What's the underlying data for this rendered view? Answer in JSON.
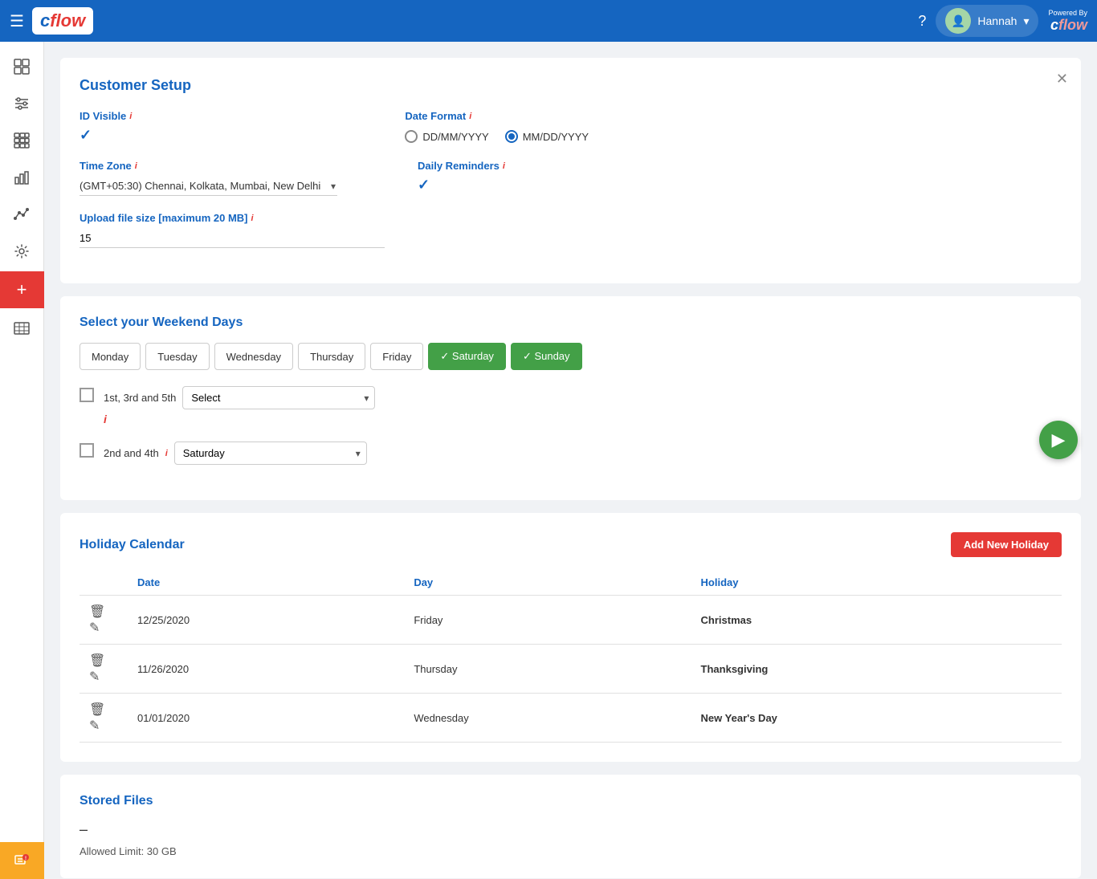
{
  "app": {
    "name": "cflow",
    "powered_by": "Powered By"
  },
  "user": {
    "name": "Hannah"
  },
  "customer_setup": {
    "title": "Customer Setup",
    "id_visible": {
      "label": "ID Visible",
      "checked": true
    },
    "date_format": {
      "label": "Date Format",
      "options": [
        "DD/MM/YYYY",
        "MM/DD/YYYY"
      ],
      "selected": "MM/DD/YYYY"
    },
    "time_zone": {
      "label": "Time Zone",
      "value": "(GMT+05:30) Chennai, Kolkata, Mumbai, New Delhi"
    },
    "daily_reminders": {
      "label": "Daily Reminders",
      "checked": true
    },
    "upload_file_size": {
      "label": "Upload file size [maximum 20 MB]",
      "value": "15"
    }
  },
  "weekend": {
    "title": "Select your Weekend Days",
    "days": [
      {
        "label": "Monday",
        "selected": false
      },
      {
        "label": "Tuesday",
        "selected": false
      },
      {
        "label": "Wednesday",
        "selected": false
      },
      {
        "label": "Thursday",
        "selected": false
      },
      {
        "label": "Friday",
        "selected": false
      },
      {
        "label": "Saturday",
        "selected": true
      },
      {
        "label": "Sunday",
        "selected": true
      }
    ],
    "row1": {
      "label": "1st, 3rd and 5th",
      "select_value": "Select",
      "select_placeholder": "Select"
    },
    "row2": {
      "label": "2nd and 4th",
      "select_value": "Saturday"
    }
  },
  "holiday_calendar": {
    "title": "Holiday Calendar",
    "add_button": "Add New Holiday",
    "columns": {
      "date": "Date",
      "day": "Day",
      "holiday": "Holiday"
    },
    "rows": [
      {
        "date": "12/25/2020",
        "day": "Friday",
        "holiday": "Christmas"
      },
      {
        "date": "11/26/2020",
        "day": "Thursday",
        "holiday": "Thanksgiving"
      },
      {
        "date": "01/01/2020",
        "day": "Wednesday",
        "holiday": "New Year's Day"
      }
    ]
  },
  "stored_files": {
    "title": "Stored Files",
    "dash": "–",
    "limit": "Allowed Limit: 30 GB"
  },
  "sidebar": {
    "items": [
      {
        "icon": "⊞",
        "name": "dashboard"
      },
      {
        "icon": "≡",
        "name": "filter"
      },
      {
        "icon": "▦",
        "name": "grid"
      },
      {
        "icon": "📊",
        "name": "chart-bar"
      },
      {
        "icon": "📈",
        "name": "chart-line"
      },
      {
        "icon": "⚙",
        "name": "settings"
      },
      {
        "icon": "⊕",
        "name": "add-widget",
        "new": true
      }
    ]
  },
  "fab": {
    "icon": "▶"
  }
}
